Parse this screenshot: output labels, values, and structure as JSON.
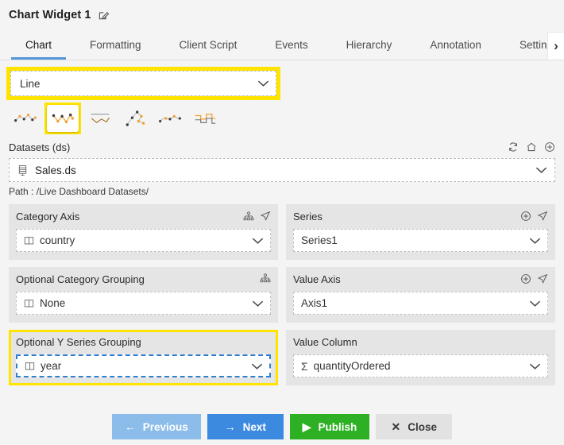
{
  "window": {
    "title": "Chart Widget 1",
    "edit_icon": "edit-pencil-icon"
  },
  "tabs": [
    {
      "label": "Chart",
      "active": true
    },
    {
      "label": "Formatting",
      "active": false
    },
    {
      "label": "Client Script",
      "active": false
    },
    {
      "label": "Events",
      "active": false
    },
    {
      "label": "Hierarchy",
      "active": false
    },
    {
      "label": "Annotation",
      "active": false
    },
    {
      "label": "Settings",
      "active": false
    }
  ],
  "tab_scroll_right": "›",
  "chart_type": {
    "selected": "Line",
    "highlighted": true,
    "variants": [
      {
        "name": "line-scatter-icon",
        "selected": false
      },
      {
        "name": "line-marker-icon",
        "selected": true
      },
      {
        "name": "line-range-icon",
        "selected": false
      },
      {
        "name": "line-path-icon",
        "selected": false
      },
      {
        "name": "line-smooth-icon",
        "selected": false
      },
      {
        "name": "line-step-icon",
        "selected": false
      }
    ]
  },
  "datasets": {
    "label": "Datasets (ds)",
    "value": "Sales.ds",
    "value_icon": "database-icon",
    "path_label": "Path : /Live Dashboard Datasets/",
    "header_icons": [
      {
        "name": "refresh-icon"
      },
      {
        "name": "home-icon"
      },
      {
        "name": "add-circle-icon"
      }
    ]
  },
  "fields": {
    "category_axis": {
      "label": "Category Axis",
      "value": "country",
      "value_icon": "column-icon",
      "icons": [
        "hierarchy-icon",
        "navigate-icon"
      ]
    },
    "series": {
      "label": "Series",
      "value": "Series1",
      "value_icon": "",
      "icons": [
        "add-circle-icon",
        "navigate-icon"
      ]
    },
    "optional_category_grouping": {
      "label": "Optional Category Grouping",
      "value": "None",
      "value_icon": "column-icon",
      "icons": [
        "hierarchy-icon"
      ]
    },
    "value_axis": {
      "label": "Value Axis",
      "value": "Axis1",
      "value_icon": "",
      "icons": [
        "add-circle-icon",
        "navigate-icon"
      ]
    },
    "optional_y_series_grouping": {
      "label": "Optional Y Series Grouping",
      "value": "year",
      "value_icon": "column-icon",
      "highlighted": true,
      "focused": true,
      "icons": []
    },
    "value_column": {
      "label": "Value Column",
      "value": "quantityOrdered",
      "value_icon": "sigma-icon",
      "icons": []
    }
  },
  "footer": {
    "previous": {
      "label": "Previous",
      "glyph": "←",
      "color": "#8cbcea"
    },
    "next": {
      "label": "Next",
      "glyph": "→",
      "color": "#3c8ae0"
    },
    "publish": {
      "label": "Publish",
      "glyph": "▶",
      "color": "#2eb024"
    },
    "close": {
      "label": "Close",
      "glyph": "✕",
      "color": "#e2e2e2"
    }
  },
  "colors": {
    "highlight_yellow": "#ffe400",
    "focus_blue": "#2f7fd1",
    "active_tab_underline": "#5596d8",
    "panel_bg": "#e5e5e5"
  }
}
